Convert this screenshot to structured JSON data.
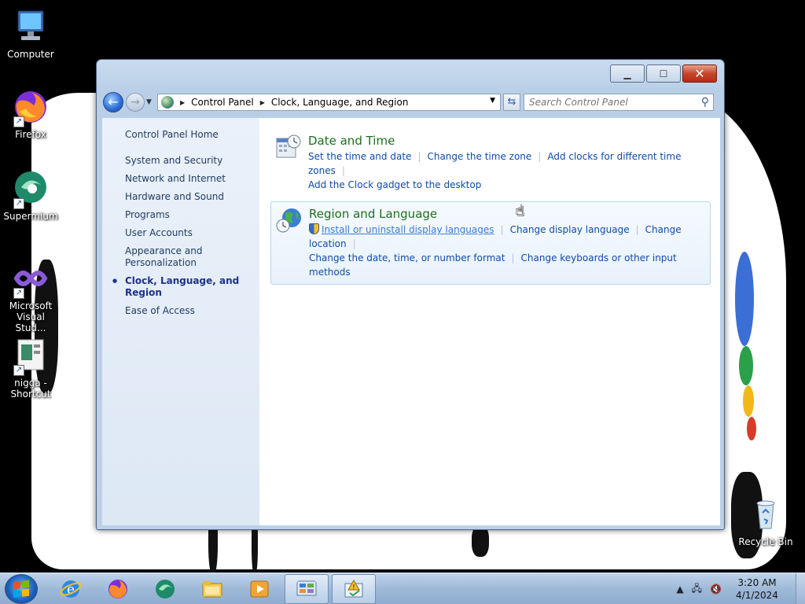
{
  "desktop": {
    "icons": [
      {
        "label": "Computer",
        "icon": "computer-icon"
      },
      {
        "label": "Firefox",
        "icon": "firefox-icon"
      },
      {
        "label": "Supermium",
        "icon": "supermium-icon"
      },
      {
        "label": "Microsoft Visual Stud...",
        "icon": "visual-studio-icon"
      },
      {
        "label": "nigga - Shortcut",
        "icon": "image-file-icon"
      },
      {
        "label": "Recycle Bin",
        "icon": "recycle-bin-icon"
      }
    ]
  },
  "window": {
    "breadcrumb": [
      "Control Panel",
      "Clock, Language, and Region"
    ],
    "search_placeholder": "Search Control Panel"
  },
  "leftpane": {
    "home": "Control Panel Home",
    "items": [
      "System and Security",
      "Network and Internet",
      "Hardware and Sound",
      "Programs",
      "User Accounts",
      "Appearance and Personalization",
      "Clock, Language, and Region",
      "Ease of Access"
    ],
    "current_index": 6
  },
  "categories": [
    {
      "title": "Date and Time",
      "icon": "clock-calendar-icon",
      "links": [
        "Set the time and date",
        "Change the time zone",
        "Add clocks for different time zones",
        "Add the Clock gadget to the desktop"
      ]
    },
    {
      "title": "Region and Language",
      "icon": "globe-clock-icon",
      "links": [
        "Install or uninstall display languages",
        "Change display language",
        "Change location",
        "Change the date, time, or number format",
        "Change keyboards or other input methods"
      ]
    }
  ],
  "taskbar": {
    "apps": [
      "internet-explorer-icon",
      "firefox-icon",
      "supermium-icon",
      "file-explorer-icon",
      "media-player-icon",
      "control-panel-icon",
      "action-center-icon"
    ],
    "clock_time": "3:20 AM",
    "clock_date": "4/1/2024"
  }
}
